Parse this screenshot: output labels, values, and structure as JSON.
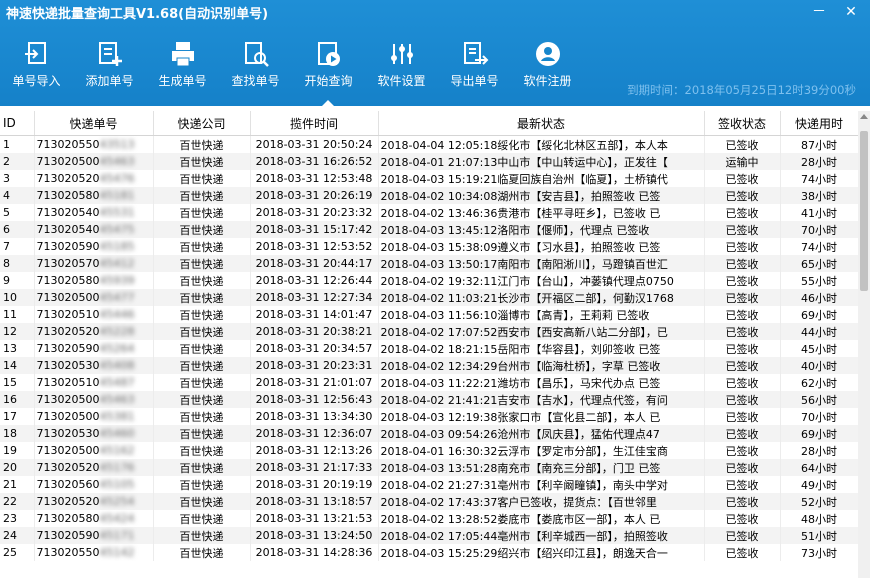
{
  "window": {
    "title": "神速快递批量查询工具V1.68(自动识别单号)",
    "minimize": "－",
    "close": "✕"
  },
  "toolbar": [
    {
      "label": "单号导入",
      "icon": "import-icon"
    },
    {
      "label": "添加单号",
      "icon": "add-icon"
    },
    {
      "label": "生成单号",
      "icon": "printer-icon"
    },
    {
      "label": "查找单号",
      "icon": "search-doc-icon"
    },
    {
      "label": "开始查询",
      "icon": "play-icon"
    },
    {
      "label": "软件设置",
      "icon": "settings-icon"
    },
    {
      "label": "导出单号",
      "icon": "export-icon"
    },
    {
      "label": "软件注册",
      "icon": "user-icon"
    }
  ],
  "expiry": "到期时间：2018年05月25日12时39分00秒",
  "columns": [
    "ID",
    "快递单号",
    "快递公司",
    "揽件时间",
    "最新状态",
    "签收状态",
    "快递用时"
  ],
  "rows": [
    [
      "1",
      "713020550",
      "43513",
      "百世快递",
      "2018-03-31 20:50:24",
      "2018-04-04  12:05:18绥化市【绥化北林区五部】，本人本",
      "已签收",
      "87小时"
    ],
    [
      "2",
      "713020500",
      "45463",
      "百世快递",
      "2018-03-31 16:26:52",
      "2018-04-01  21:07:13中山市【中山转运中心】，正发往【",
      "运输中",
      "28小时"
    ],
    [
      "3",
      "713020520",
      "45476",
      "百世快递",
      "2018-03-31 12:53:48",
      "2018-04-03  15:19:21临夏回族自治州【临夏】，土桥镇代",
      "已签收",
      "74小时"
    ],
    [
      "4",
      "713020580",
      "45181",
      "百世快递",
      "2018-03-31 20:26:19",
      "2018-04-02  10:34:08湖州市【安吉县】，拍照签收  已签",
      "已签收",
      "38小时"
    ],
    [
      "5",
      "713020540",
      "45531",
      "百世快递",
      "2018-03-31 20:23:32",
      "2018-04-02  13:46:36贵港市【桂平寻旺乡】，已签收  已",
      "已签收",
      "41小时"
    ],
    [
      "6",
      "713020540",
      "45475",
      "百世快递",
      "2018-03-31 15:17:42",
      "2018-04-03  13:45:12洛阳市【偃师】，代理点  已签收",
      "已签收",
      "70小时"
    ],
    [
      "7",
      "713020590",
      "45185",
      "百世快递",
      "2018-03-31 12:53:52",
      "2018-04-03  15:38:09遵义市【习水县】，拍照签收  已签",
      "已签收",
      "74小时"
    ],
    [
      "8",
      "713020570",
      "45412",
      "百世快递",
      "2018-03-31 20:44:17",
      "2018-04-03  13:50:17南阳市【南阳淅川】，马蹬镇百世汇",
      "已签收",
      "65小时"
    ],
    [
      "9",
      "713020580",
      "45939",
      "百世快递",
      "2018-03-31 12:26:44",
      "2018-04-02  19:32:11江门市【台山】，冲蒌镇代理点0750",
      "已签收",
      "55小时"
    ],
    [
      "10",
      "713020500",
      "45477",
      "百世快递",
      "2018-03-31 12:27:34",
      "2018-04-02  11:03:21长沙市【开福区二部】，何勤汉1768",
      "已签收",
      "46小时"
    ],
    [
      "11",
      "713020510",
      "45446",
      "百世快递",
      "2018-03-31 14:01:47",
      "2018-04-03  11:56:10淄博市【高青】，王莉莉  已签收",
      "已签收",
      "69小时"
    ],
    [
      "12",
      "713020520",
      "45228",
      "百世快递",
      "2018-03-31 20:38:21",
      "2018-04-02  17:07:52西安市【西安高新八站二分部】，已",
      "已签收",
      "44小时"
    ],
    [
      "13",
      "713020590",
      "45264",
      "百世快递",
      "2018-03-31 20:34:57",
      "2018-04-02  18:21:15岳阳市【华容县】，刘卯签收  已签",
      "已签收",
      "45小时"
    ],
    [
      "14",
      "713020530",
      "45408",
      "百世快递",
      "2018-03-31 20:23:31",
      "2018-04-02  12:34:29台州市【临海杜桥】，字草  已签收",
      "已签收",
      "40小时"
    ],
    [
      "15",
      "713020510",
      "45487",
      "百世快递",
      "2018-03-31 21:01:07",
      "2018-04-03  11:22:21潍坊市【昌乐】，马宋代办点  已签",
      "已签收",
      "62小时"
    ],
    [
      "16",
      "713020500",
      "45463",
      "百世快递",
      "2018-03-31 12:56:43",
      "2018-04-02  21:41:21吉安市【吉水】，代理点代签，有问",
      "已签收",
      "56小时"
    ],
    [
      "17",
      "713020500",
      "45381",
      "百世快递",
      "2018-03-31 13:34:30",
      "2018-04-03  12:19:38张家口市【宣化县二部】，本人  已",
      "已签收",
      "70小时"
    ],
    [
      "18",
      "713020530",
      "45460",
      "百世快递",
      "2018-03-31 12:36:07",
      "2018-04-03  09:54:26沧州市【凤庆县】，猛佑代理点47",
      "已签收",
      "69小时"
    ],
    [
      "19",
      "713020500",
      "45162",
      "百世快递",
      "2018-03-31 12:13:26",
      "2018-04-01  16:30:32云浮市【罗定市分部】，生江佳宝商",
      "已签收",
      "28小时"
    ],
    [
      "20",
      "713020520",
      "45176",
      "百世快递",
      "2018-03-31 21:17:33",
      "2018-04-03  13:51:28南充市【南充三分部】，门卫  已签",
      "已签收",
      "64小时"
    ],
    [
      "21",
      "713020560",
      "45105",
      "百世快递",
      "2018-03-31 20:19:19",
      "2018-04-02  21:27:31亳州市【利辛阚疃镇】，南头中学对",
      "已签收",
      "49小时"
    ],
    [
      "22",
      "713020520",
      "45254",
      "百世快递",
      "2018-03-31 13:18:57",
      "2018-04-02  17:43:37客户已签收，提货点：【百世邻里",
      "已签收",
      "52小时"
    ],
    [
      "23",
      "713020580",
      "45424",
      "百世快递",
      "2018-03-31 13:21:53",
      "2018-04-02  13:28:52娄底市【娄底市区一部】，本人  已",
      "已签收",
      "48小时"
    ],
    [
      "24",
      "713020590",
      "45171",
      "百世快递",
      "2018-03-31 13:24:50",
      "2018-04-02  17:05:44亳州市【利辛城西一部】，拍照签收",
      "已签收",
      "51小时"
    ],
    [
      "25",
      "713020550",
      "45142",
      "百世快递",
      "2018-03-31 14:28:36",
      "2018-04-03  15:25:29绍兴市【绍兴印江县】，朗逸天合一",
      "已签收",
      "73小时"
    ]
  ]
}
